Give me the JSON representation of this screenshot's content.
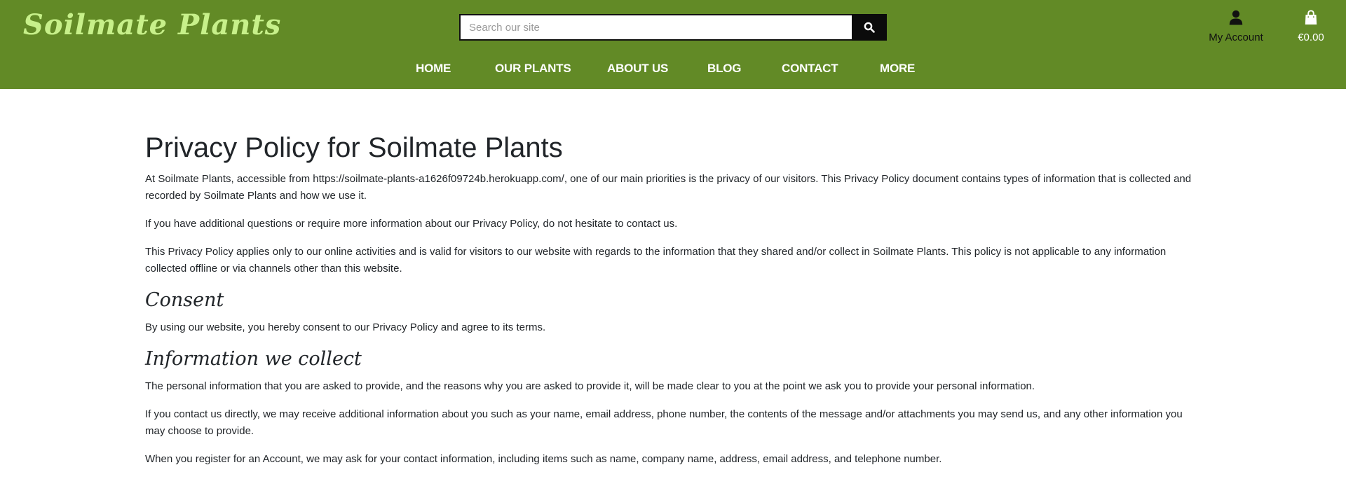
{
  "header": {
    "logo": "Soilmate Plants",
    "search": {
      "placeholder": "Search our site"
    },
    "nav": [
      "HOME",
      "OUR PLANTS",
      "ABOUT US",
      "BLOG",
      "CONTACT",
      "MORE"
    ],
    "account_label": "My Account",
    "cart_total": "€0.00",
    "colors": {
      "bar": "#628a26",
      "logo": "#c7f08a"
    }
  },
  "content": {
    "title": "Privacy Policy for Soilmate Plants",
    "intro": [
      "At Soilmate Plants, accessible from https://soilmate-plants-a1626f09724b.herokuapp.com/, one of our main priorities is the privacy of our visitors. This Privacy Policy document contains types of information that is collected and recorded by Soilmate Plants and how we use it.",
      "If you have additional questions or require more information about our Privacy Policy, do not hesitate to contact us.",
      "This Privacy Policy applies only to our online activities and is valid for visitors to our website with regards to the information that they shared and/or collect in Soilmate Plants. This policy is not applicable to any information collected offline or via channels other than this website."
    ],
    "consent": {
      "heading": "Consent",
      "text": "By using our website, you hereby consent to our Privacy Policy and agree to its terms."
    },
    "info": {
      "heading": "Information we collect",
      "paragraphs": [
        "The personal information that you are asked to provide, and the reasons why you are asked to provide it, will be made clear to you at the point we ask you to provide your personal information.",
        "If you contact us directly, we may receive additional information about you such as your name, email address, phone number, the contents of the message and/or attachments you may send us, and any other information you may choose to provide.",
        "When you register for an Account, we may ask for your contact information, including items such as name, company name, address, email address, and telephone number."
      ]
    }
  }
}
